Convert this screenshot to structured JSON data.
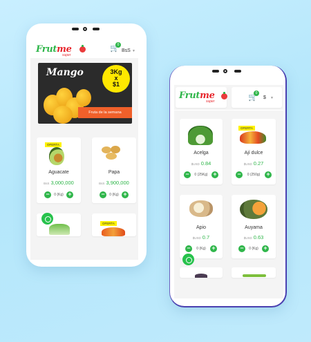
{
  "brand": {
    "name_a": "Frut",
    "name_b": "me",
    "sub": "super"
  },
  "colors": {
    "green": "#2fb64a",
    "red": "#e7252c",
    "orange": "#f0602a",
    "yellow": "#fff200",
    "bg": "#c2ecfd"
  },
  "phone1": {
    "cart_count": "0",
    "currency": "BsS",
    "banner": {
      "title": "Mango",
      "price_top": "3Kg",
      "price_mid": "x",
      "price_bot": "$1",
      "button": "Fruta de la semana"
    },
    "products": [
      {
        "name": "Aguacate",
        "currency": "BsS",
        "price": "3,000,000",
        "qty": "0",
        "unit": "(Kg)",
        "badge": "OFERTA"
      },
      {
        "name": "Papa",
        "currency": "BsS",
        "price": "3,900,000",
        "qty": "0",
        "unit": "(Kg)",
        "badge": ""
      },
      {
        "name": "",
        "badge": ""
      },
      {
        "name": "",
        "badge": "OFERTA"
      }
    ]
  },
  "phone2": {
    "cart_count": "0",
    "currency": "$",
    "products": [
      {
        "name": "Acelga",
        "currency": "$USD",
        "price": "0.84",
        "qty": "0",
        "unit": "(25Kg)",
        "badge": ""
      },
      {
        "name": "Ají dulce",
        "currency": "$USD",
        "price": "0.27",
        "qty": "0",
        "unit": "(250g)",
        "badge": "OFERTA"
      },
      {
        "name": "Apio",
        "currency": "$USD",
        "price": "0.7",
        "qty": "0",
        "unit": "(Kg)",
        "badge": ""
      },
      {
        "name": "Auyama",
        "currency": "$USD",
        "price": "0.63",
        "qty": "0",
        "unit": "(Kg)",
        "badge": ""
      }
    ]
  },
  "icons": {
    "cart": "cart-icon",
    "whatsapp": "whatsapp-icon",
    "minus": "minus-icon",
    "plus": "plus-icon",
    "caret": "chevron-down-icon"
  }
}
